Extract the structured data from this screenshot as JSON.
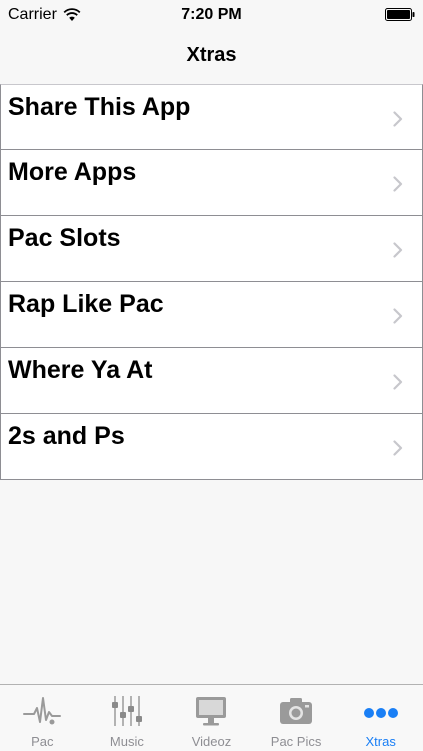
{
  "status_bar": {
    "carrier": "Carrier",
    "time": "7:20 PM",
    "wifi_icon": "wifi-icon",
    "battery_icon": "battery-icon"
  },
  "nav": {
    "title": "Xtras"
  },
  "list": {
    "items": [
      {
        "label": "Share This App",
        "icon": "chevron-right-icon"
      },
      {
        "label": "More Apps",
        "icon": "chevron-right-icon"
      },
      {
        "label": "Pac Slots",
        "icon": "chevron-right-icon"
      },
      {
        "label": "Rap Like Pac",
        "icon": "chevron-right-icon"
      },
      {
        "label": "Where Ya At",
        "icon": "chevron-right-icon"
      },
      {
        "label": "2s and Ps",
        "icon": "chevron-right-icon"
      }
    ]
  },
  "tab_bar": {
    "tabs": [
      {
        "label": "Pac",
        "icon": "heartbeat-icon",
        "active": false
      },
      {
        "label": "Music",
        "icon": "equalizer-icon",
        "active": false
      },
      {
        "label": "Videoz",
        "icon": "monitor-icon",
        "active": false
      },
      {
        "label": "Pac Pics",
        "icon": "camera-icon",
        "active": false
      },
      {
        "label": "Xtras",
        "icon": "more-dots-icon",
        "active": true
      }
    ]
  },
  "colors": {
    "accent": "#1a7ff5",
    "inactive_tab": "#8e8e93",
    "background": "#f7f7f7",
    "cell_background": "#ffffff"
  }
}
